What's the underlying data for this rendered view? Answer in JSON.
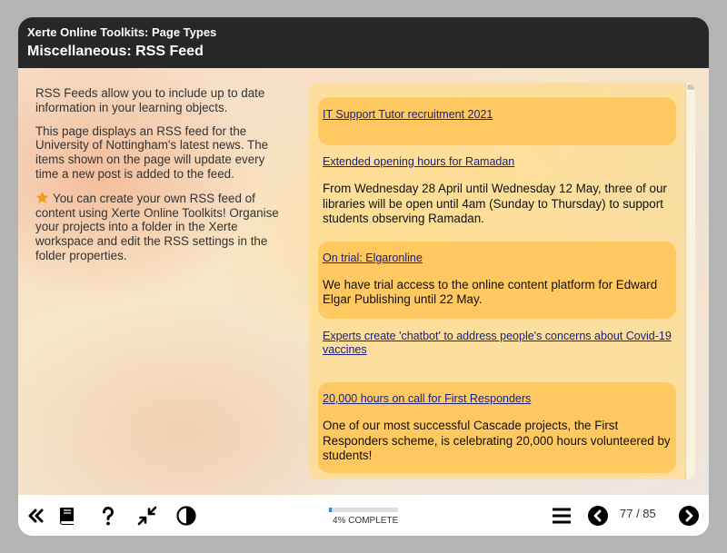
{
  "header": {
    "app_title": "Xerte Online Toolkits: Page Types",
    "page_title": "Miscellaneous: RSS Feed"
  },
  "intro": {
    "paragraph1": "RSS Feeds allow you to include up to date information in your learning objects.",
    "paragraph2": "This page displays an RSS feed for the University of Nottingham's latest news. The items shown on the page will update every time a new post is added to the feed.",
    "paragraph3": "You can create your own RSS feed of content using Xerte Online Toolkits! Organise your projects into a folder in the Xerte workspace and edit the RSS settings in the folder properties.",
    "star_icon": "star-icon",
    "star_color": "#f39c12"
  },
  "feed": {
    "items": [
      {
        "title": "IT Support Tutor recruitment 2021",
        "description": ""
      },
      {
        "title": "Extended opening hours for Ramadan",
        "description": "From Wednesday 28 April until Wednesday 12 May, three of our libraries will be open until 4am (Sunday to Thursday) to support students observing Ramadan."
      },
      {
        "title": "On trial: Elgaronline",
        "description": "We have trial access to the online content platform for Edward Elgar Publishing until 22 May."
      },
      {
        "title": "Experts create 'chatbot' to address people's concerns about Covid-19 vaccines",
        "description": ""
      },
      {
        "title": "20,000 hours on call for First Responders",
        "description": "One of our most successful Cascade projects, the First Responders scheme, is celebrating 20,000 hours volunteered by students!"
      }
    ]
  },
  "footer": {
    "progress_label": "4% COMPLETE",
    "progress_percent": 4,
    "page_counter": "77 / 85",
    "icons": [
      "double-chevron-left-icon",
      "glossary-book-icon",
      "help-icon",
      "minimize-icon",
      "contrast-icon",
      "menu-icon",
      "previous-icon",
      "next-icon"
    ]
  },
  "colors": {
    "header_bg": "#272727",
    "accent_item": "#ffc860",
    "link": "#1a237e",
    "progress": "#1e88e5"
  }
}
